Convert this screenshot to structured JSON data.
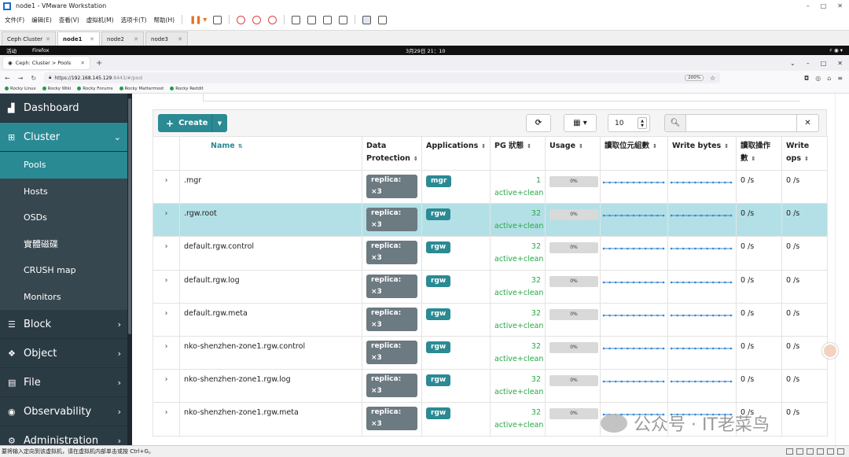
{
  "vmware": {
    "title": "node1 - VMware Workstation",
    "menu": [
      "文件(F)",
      "编辑(E)",
      "查看(V)",
      "虚拟机(M)",
      "选项卡(T)",
      "帮助(H)"
    ],
    "tabs": [
      {
        "label": "Ceph Cluster",
        "active": false
      },
      {
        "label": "node1",
        "active": true
      },
      {
        "label": "node2",
        "active": false
      },
      {
        "label": "node3",
        "active": false
      }
    ],
    "status_text": "要将输入定向到该虚拟机，请在虚拟机内部单击或按 Ctrl+G。"
  },
  "gnome": {
    "activities": "活动",
    "app": "Firefox",
    "clock": "3月29日 21：10"
  },
  "firefox": {
    "tab_title": "Ceph: Cluster > Pools",
    "url_prefix": "https://",
    "url_host": "192.168.145.129",
    "url_rest": ":8443/#/pool",
    "zoom": "200%",
    "bookmarks": [
      "Rocky Linux",
      "Rocky Wiki",
      "Rocky Forums",
      "Rocky Mattermost",
      "Rocky Reddit"
    ]
  },
  "sidebar": {
    "items": [
      {
        "label": "Dashboard",
        "icon": "bar-chart-icon"
      },
      {
        "label": "Cluster",
        "icon": "sitemap-icon",
        "open": true
      },
      {
        "label": "Block",
        "icon": "database-icon"
      },
      {
        "label": "Object",
        "icon": "cubes-icon"
      },
      {
        "label": "File",
        "icon": "file-icon"
      },
      {
        "label": "Observability",
        "icon": "eye-icon"
      },
      {
        "label": "Administration",
        "icon": "cogs-icon"
      }
    ],
    "cluster_sub": [
      "Pools",
      "Hosts",
      "OSDs",
      "實體磁碟",
      "CRUSH map",
      "Monitors"
    ],
    "active_sub": "Pools"
  },
  "toolbar": {
    "create_label": "Create",
    "per_page": "10",
    "search_value": ""
  },
  "table": {
    "columns": [
      "Name",
      "Data Protection",
      "Applications",
      "PG 狀態",
      "Usage",
      "讀取位元組數",
      "Write bytes",
      "讀取操作數",
      "Write ops"
    ],
    "rows": [
      {
        "name": ".mgr",
        "protection": "replica: ×3",
        "app": "mgr",
        "pg_count": "1",
        "pg_state": "active+clean",
        "usage": "0%",
        "read_ops": "0 /s",
        "write_ops": "0 /s",
        "selected": false
      },
      {
        "name": ".rgw.root",
        "protection": "replica: ×3",
        "app": "rgw",
        "pg_count": "32",
        "pg_state": "active+clean",
        "usage": "0%",
        "read_ops": "0 /s",
        "write_ops": "0 /s",
        "selected": true
      },
      {
        "name": "default.rgw.control",
        "protection": "replica: ×3",
        "app": "rgw",
        "pg_count": "32",
        "pg_state": "active+clean",
        "usage": "0%",
        "read_ops": "0 /s",
        "write_ops": "0 /s",
        "selected": false
      },
      {
        "name": "default.rgw.log",
        "protection": "replica: ×3",
        "app": "rgw",
        "pg_count": "32",
        "pg_state": "active+clean",
        "usage": "0%",
        "read_ops": "0 /s",
        "write_ops": "0 /s",
        "selected": false
      },
      {
        "name": "default.rgw.meta",
        "protection": "replica: ×3",
        "app": "rgw",
        "pg_count": "32",
        "pg_state": "active+clean",
        "usage": "0%",
        "read_ops": "0 /s",
        "write_ops": "0 /s",
        "selected": false
      },
      {
        "name": "nko-shenzhen-zone1.rgw.control",
        "protection": "replica: ×3",
        "app": "rgw",
        "pg_count": "32",
        "pg_state": "active+clean",
        "usage": "0%",
        "read_ops": "0 /s",
        "write_ops": "0 /s",
        "selected": false
      },
      {
        "name": "nko-shenzhen-zone1.rgw.log",
        "protection": "replica: ×3",
        "app": "rgw",
        "pg_count": "32",
        "pg_state": "active+clean",
        "usage": "0%",
        "read_ops": "0 /s",
        "write_ops": "0 /s",
        "selected": false
      },
      {
        "name": "nko-shenzhen-zone1.rgw.meta",
        "protection": "replica: ×3",
        "app": "rgw",
        "pg_count": "32",
        "pg_state": "active+clean",
        "usage": "0%",
        "read_ops": "0 /s",
        "write_ops": "0 /s",
        "selected": false
      }
    ]
  },
  "watermark": "公众号 · IT老菜鸟",
  "colors": {
    "accent": "#2b8a93",
    "sidebar_bg": "#2b3b44",
    "selected_row": "#b3e0e6",
    "pg_ok": "#27a744",
    "sparkline": "#3a86d6"
  }
}
